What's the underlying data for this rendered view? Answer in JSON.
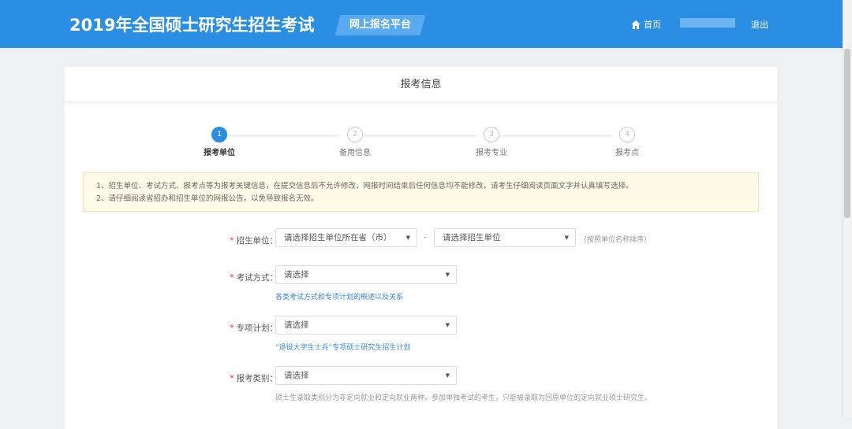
{
  "header": {
    "title": "2019年全国硕士研究生招生考试",
    "platform": "网上报名平台",
    "home": "首页",
    "logout": "退出"
  },
  "card": {
    "title": "报考信息"
  },
  "steps": [
    {
      "num": "1",
      "label": "报考单位"
    },
    {
      "num": "2",
      "label": "备用信息"
    },
    {
      "num": "3",
      "label": "报考专业"
    },
    {
      "num": "4",
      "label": "报考点"
    }
  ],
  "notice": [
    "1、招生单位、考试方式、报考点等为报考关键信息，在提交信息后不允许修改，网报时间结束后任何信息均不能修改，请考生仔细阅读页面文字并认真填写选择。",
    "2、请仔细阅读省招办和招生单位的网报公告，以免导致报名无效。"
  ],
  "form": {
    "unit": {
      "label": "招生单位：",
      "province": "请选择招生单位所在省（市）",
      "dash": "-",
      "school": "请选择招生单位",
      "note": "（按照单位名称排序）"
    },
    "exam_mode": {
      "label": "考试方式：",
      "value": "请选择",
      "hint": "各类考试方式和专项计划的概述以及关系"
    },
    "special_plan": {
      "label": "专项计划：",
      "value": "请选择",
      "hint": "“退役大学生士兵”专项硕士研究生招生计划"
    },
    "category": {
      "label": "报考类别：",
      "value": "请选择",
      "hint": "硕士生录取类别分为非定向就业和定向就业两种。参加单独考试的考生，只能被录取为回原单位的定向就业硕士研究生。"
    }
  },
  "required_mark": "*",
  "arrow": "▼"
}
